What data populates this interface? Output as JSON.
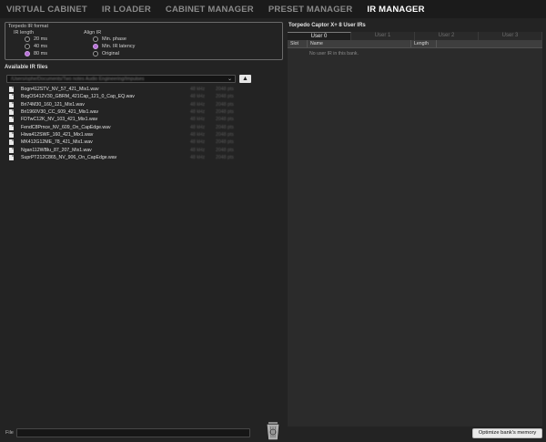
{
  "nav": {
    "tabs": [
      {
        "label": "VIRTUAL CABINET"
      },
      {
        "label": "IR LOADER"
      },
      {
        "label": "CABINET MANAGER"
      },
      {
        "label": "PRESET MANAGER"
      },
      {
        "label": "IR MANAGER"
      }
    ],
    "active_tab": "IR MANAGER"
  },
  "ir_format": {
    "title": "Torpedo IR format",
    "ir_length": {
      "label": "IR length",
      "options": [
        "20 ms",
        "40 ms",
        "80 ms"
      ],
      "selected": "80 ms"
    },
    "align_ir": {
      "label": "Align IR",
      "options": [
        "Min. phase",
        "Min. IR latency",
        "Original"
      ],
      "selected": "Min. IR latency"
    }
  },
  "available": {
    "title": "Available IR files",
    "path": "/Users/ophe/Documents/Two notes Audio Engineering/Impulses",
    "files": [
      {
        "name": "Bogn412STV_NV_57_421_Mix1.wav",
        "m1": "48 kHz",
        "m2": "2048 pts"
      },
      {
        "name": "BogOS412V30_GBRM_421Cap_121_0_Cap_EQ.wav",
        "m1": "48 kHz",
        "m2": "2048 pts"
      },
      {
        "name": "Bri74M30_160_121_Mix1.wav",
        "m1": "48 kHz",
        "m2": "2048 pts"
      },
      {
        "name": "Bri1960V30_CC_609_421_Mix1.wav",
        "m1": "48 kHz",
        "m2": "2048 pts"
      },
      {
        "name": "FDTwC12K_NV_103_421_Mix1.wav",
        "m1": "48 kHz",
        "m2": "2048 pts"
      },
      {
        "name": "FendC8Prnce_NV_609_On_CapEdge.wav",
        "m1": "48 kHz",
        "m2": "2048 pts"
      },
      {
        "name": "Hiwa412SWF_160_421_Mix1.wav",
        "m1": "48 kHz",
        "m2": "2048 pts"
      },
      {
        "name": "MK412G12ME_78_421_Mix1.wav",
        "m1": "48 kHz",
        "m2": "2048 pts"
      },
      {
        "name": "Ngan112WBlu_87_207_Mix1.wav",
        "m1": "48 kHz",
        "m2": "2048 pts"
      },
      {
        "name": "SuprPT212C865_NV_906_On_CapEdge.wav",
        "m1": "48 kHz",
        "m2": "2048 pts"
      }
    ]
  },
  "user_irs": {
    "title": "Torpedo Captor X+ 8 User IRs",
    "tabs": [
      "User 0",
      "User 1",
      "User 2",
      "User 3"
    ],
    "active_tab": "User 0",
    "columns": {
      "slot": "Slot",
      "name": "Name",
      "length": "Length"
    },
    "empty_message": "No user IR in this bank."
  },
  "bottom": {
    "file_label": "File",
    "file_value": "",
    "optimize_label": "Optimize bank's memory"
  }
}
